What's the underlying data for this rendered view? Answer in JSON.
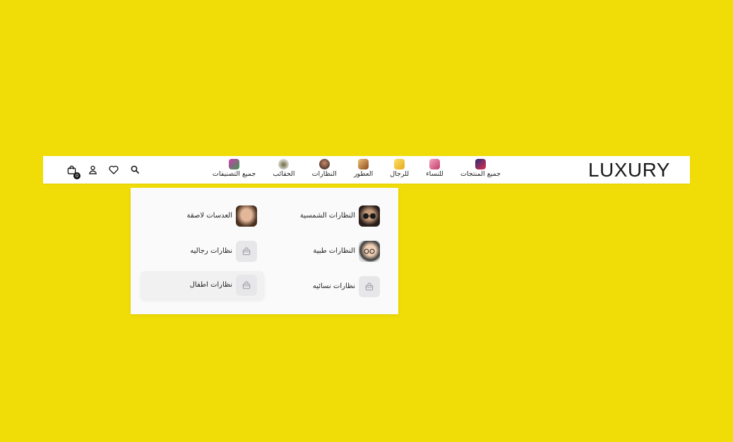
{
  "brand": {
    "logo": "LUXURY"
  },
  "nav": {
    "items": [
      {
        "label": "جميع المنتجات",
        "icon": "all-products-icon",
        "color": "#5a2fb5"
      },
      {
        "label": "للنساء",
        "icon": "women-icon",
        "color": "#f07aa0"
      },
      {
        "label": "للرجال",
        "icon": "men-icon",
        "color": "#f3c52b"
      },
      {
        "label": "العطور",
        "icon": "perfume-icon",
        "color": "#c9762b"
      },
      {
        "label": "النظارات",
        "icon": "glasses-icon",
        "color": "#3a2a24"
      },
      {
        "label": "الحقائب",
        "icon": "bags-icon",
        "color": "#6a6a40"
      },
      {
        "label": "جميع التصنيفات",
        "icon": "all-categories-icon",
        "color": "#8a2bb5"
      }
    ]
  },
  "header_icons": {
    "cart_count": "0"
  },
  "dropdown": {
    "items": [
      {
        "label": "النظارات الشمسية",
        "icon": "sunglasses-photo",
        "active": false
      },
      {
        "label": "العدسات لاصقة",
        "icon": "contact-lenses-photo",
        "active": false
      },
      {
        "label": "النظارات طبية",
        "icon": "medical-glasses-photo",
        "active": false
      },
      {
        "label": "نظارات رجاليه",
        "icon": "bag-placeholder-icon",
        "active": false
      },
      {
        "label": "نظارات نسائيه",
        "icon": "bag-placeholder-icon",
        "active": false
      },
      {
        "label": "نظارات اطفال",
        "icon": "bag-placeholder-icon",
        "active": true
      }
    ]
  },
  "colors": {
    "background": "#f0dc06",
    "header": "#ffffff",
    "menu": "#fafafa"
  }
}
